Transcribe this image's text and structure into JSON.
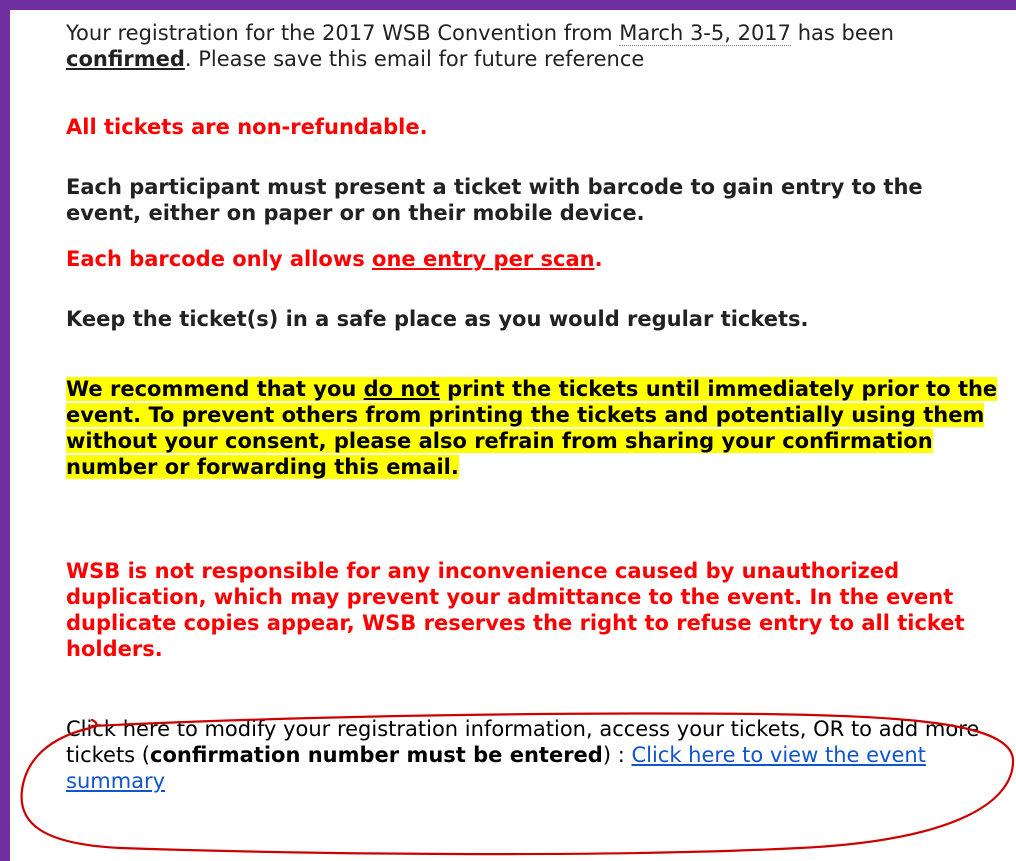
{
  "intro": {
    "p1": "Your registration for the 2017 WSB Convention from ",
    "date_range": "March 3-5, 2017",
    "p2": " has been ",
    "confirmed": "confirmed",
    "p3": ". Please save this email for future reference"
  },
  "non_refundable": "All tickets are non-refundable.",
  "entry_notice": "Each participant must present a ticket with barcode to gain entry to the event, either on paper or on their mobile device.",
  "barcode": {
    "prefix": "Each barcode only allows ",
    "underlined": "one entry per scan",
    "suffix": "."
  },
  "safe_place": "Keep the ticket(s) in a safe place as you would regular tickets.",
  "recommend": {
    "part1": "We recommend that you ",
    "underlined": "do not",
    "part2": " print the tickets until immediately prior to the event. To prevent others from printing the tickets and potentially using them without your consent, please also refrain from sharing your confirmation number or forwarding this email."
  },
  "disclaimer": "WSB is not responsible for any inconvenience caused by unauthorized duplication, which may prevent your admittance to the event. In the event duplicate copies appear, WSB reserves the right to refuse entry to all ticket holders.",
  "modify": {
    "part1": "Click here to modify your registration information, access your tickets, OR to add more tickets (",
    "bold": "confirmation number must be entered",
    "part2": ") :  ",
    "link": "Click here to view the event summary"
  },
  "colors": {
    "frame": "#7030a0",
    "warning_red": "#ff0000",
    "highlight": "#ffff00",
    "link_blue": "#1155cc",
    "annotation_red": "#cc0000"
  }
}
